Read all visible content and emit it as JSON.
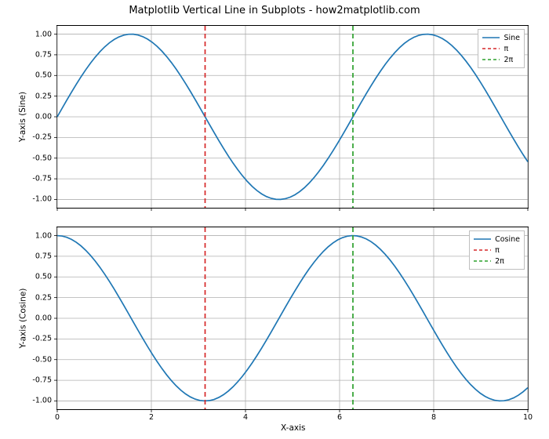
{
  "suptitle": "Matplotlib Vertical Line in Subplots - how2matplotlib.com",
  "xlabel": "X-axis",
  "axes": [
    {
      "ylabel": "Y-axis (Sine)",
      "legend": [
        "Sine",
        "π",
        "2π"
      ]
    },
    {
      "ylabel": "Y-axis (Cosine)",
      "legend": [
        "Cosine",
        "π",
        "2π"
      ]
    }
  ],
  "xticks": [
    "0",
    "2",
    "4",
    "6",
    "8",
    "10"
  ],
  "yticks": [
    "-1.00",
    "-0.75",
    "-0.50",
    "-0.25",
    "0.00",
    "0.25",
    "0.50",
    "0.75",
    "1.00"
  ],
  "colors": {
    "curve": "#1f77b4",
    "pi": "#d62728",
    "twopi": "#2ca02c",
    "grid": "#b0b0b0"
  },
  "chart_data": [
    {
      "type": "line",
      "title": "",
      "xlabel": "X-axis",
      "ylabel": "Y-axis (Sine)",
      "xlim": [
        0,
        10
      ],
      "ylim": [
        -1.1,
        1.1
      ],
      "grid": true,
      "legend_position": "upper right",
      "series": [
        {
          "name": "Sine",
          "kind": "curve",
          "function": "sin(x)",
          "x_range": [
            0,
            10
          ],
          "n_points": 100
        },
        {
          "name": "π",
          "kind": "vline",
          "x": 3.14159,
          "linestyle": "--",
          "color": "r"
        },
        {
          "name": "2π",
          "kind": "vline",
          "x": 6.28319,
          "linestyle": "--",
          "color": "g"
        }
      ],
      "xticks": [
        0,
        2,
        4,
        6,
        8,
        10
      ],
      "yticks": [
        -1.0,
        -0.75,
        -0.5,
        -0.25,
        0.0,
        0.25,
        0.5,
        0.75,
        1.0
      ]
    },
    {
      "type": "line",
      "title": "",
      "xlabel": "X-axis",
      "ylabel": "Y-axis (Cosine)",
      "xlim": [
        0,
        10
      ],
      "ylim": [
        -1.1,
        1.1
      ],
      "grid": true,
      "legend_position": "upper right",
      "series": [
        {
          "name": "Cosine",
          "kind": "curve",
          "function": "cos(x)",
          "x_range": [
            0,
            10
          ],
          "n_points": 100
        },
        {
          "name": "π",
          "kind": "vline",
          "x": 3.14159,
          "linestyle": "--",
          "color": "r"
        },
        {
          "name": "2π",
          "kind": "vline",
          "x": 6.28319,
          "linestyle": "--",
          "color": "g"
        }
      ],
      "xticks": [
        0,
        2,
        4,
        6,
        8,
        10
      ],
      "yticks": [
        -1.0,
        -0.75,
        -0.5,
        -0.25,
        0.0,
        0.25,
        0.5,
        0.75,
        1.0
      ]
    }
  ]
}
